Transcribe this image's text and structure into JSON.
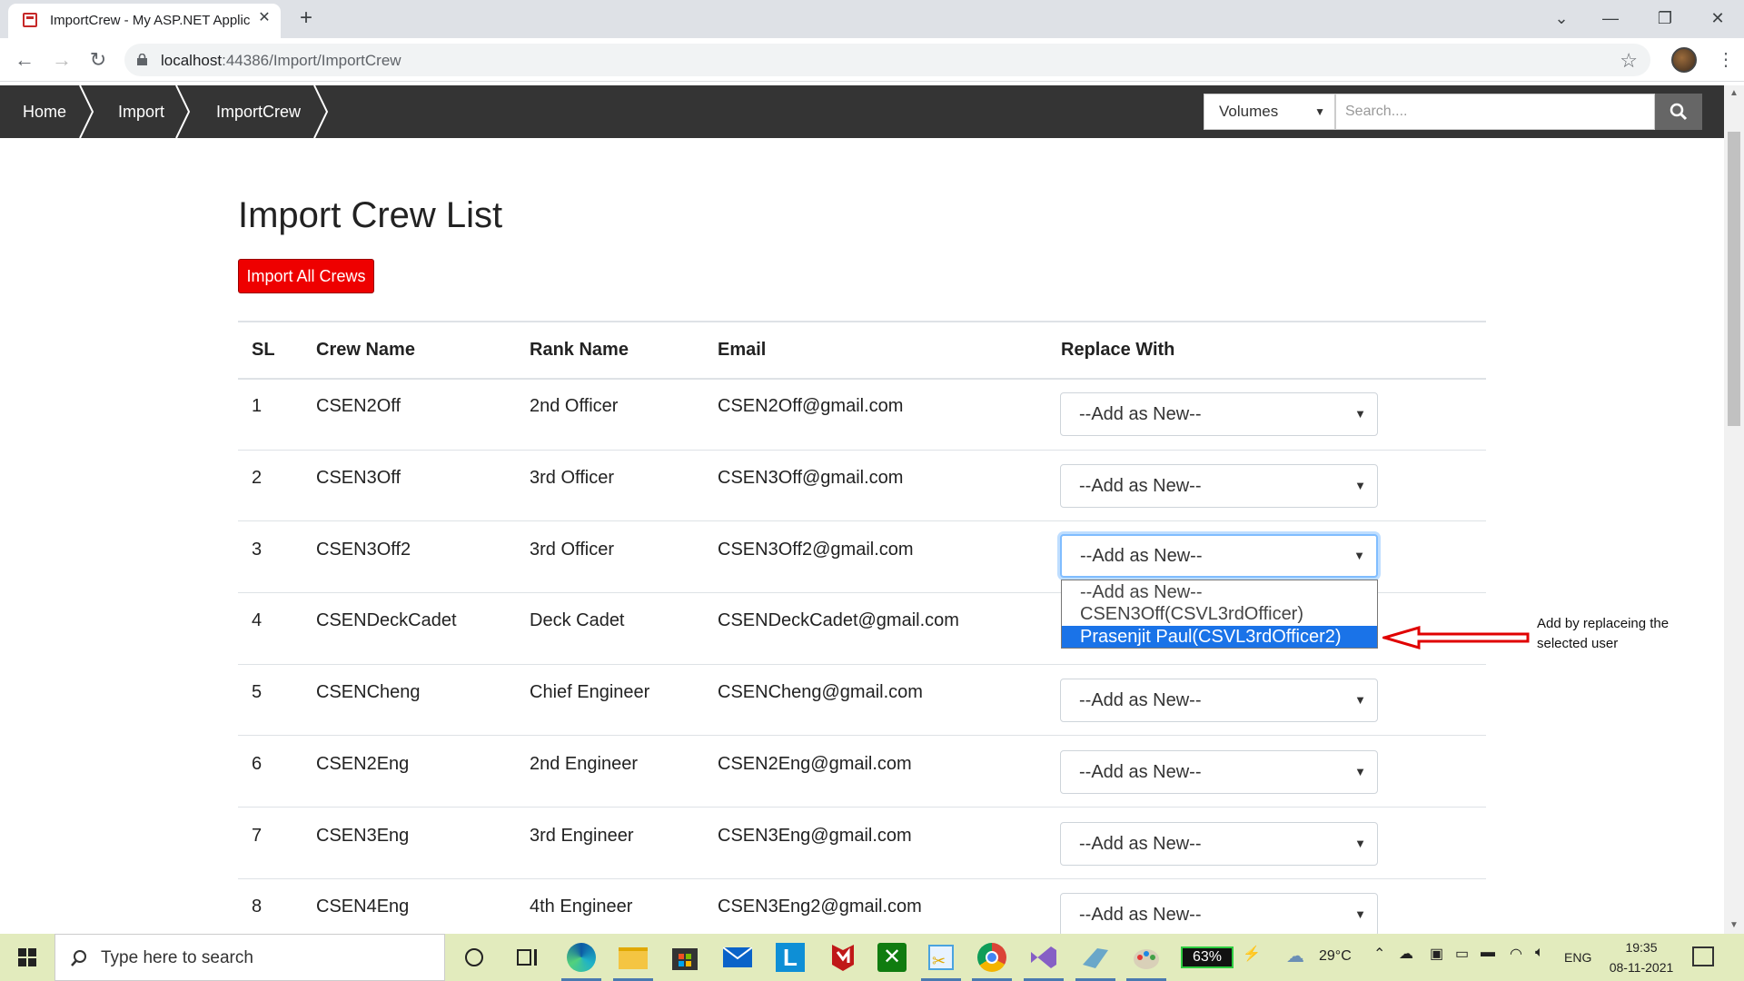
{
  "browser": {
    "tab_title": "ImportCrew - My ASP.NET Applic",
    "url_host": "localhost",
    "url_rest": ":44386/Import/ImportCrew"
  },
  "nav": {
    "breadcrumbs": [
      "Home",
      "Import",
      "ImportCrew"
    ],
    "volumes_label": "Volumes",
    "search_placeholder": "Search...."
  },
  "page": {
    "title": "Import Crew List",
    "import_all_label": "Import All Crews"
  },
  "table": {
    "headers": [
      "SL",
      "Crew Name",
      "Rank Name",
      "Email",
      "Replace With"
    ],
    "rows": [
      {
        "sl": "1",
        "name": "CSEN2Off",
        "rank": "2nd Officer",
        "email": "CSEN2Off@gmail.com",
        "replace": "--Add as New--"
      },
      {
        "sl": "2",
        "name": "CSEN3Off",
        "rank": "3rd Officer",
        "email": "CSEN3Off@gmail.com",
        "replace": "--Add as New--"
      },
      {
        "sl": "3",
        "name": "CSEN3Off2",
        "rank": "3rd Officer",
        "email": "CSEN3Off2@gmail.com",
        "replace": "--Add as New--"
      },
      {
        "sl": "4",
        "name": "CSENDeckCadet",
        "rank": "Deck Cadet",
        "email": "CSENDeckCadet@gmail.com",
        "replace": ""
      },
      {
        "sl": "5",
        "name": "CSENCheng",
        "rank": "Chief Engineer",
        "email": "CSENCheng@gmail.com",
        "replace": "--Add as New--"
      },
      {
        "sl": "6",
        "name": "CSEN2Eng",
        "rank": "2nd Engineer",
        "email": "CSEN2Eng@gmail.com",
        "replace": "--Add as New--"
      },
      {
        "sl": "7",
        "name": "CSEN3Eng",
        "rank": "3rd Engineer",
        "email": "CSEN3Eng@gmail.com",
        "replace": "--Add as New--"
      },
      {
        "sl": "8",
        "name": "CSEN4Eng",
        "rank": "4th Engineer",
        "email": "CSEN3Eng2@gmail.com",
        "replace": "--Add as New--"
      }
    ],
    "dropdown_options": [
      "--Add as New--",
      "CSEN3Off(CSVL3rdOfficer)",
      "Prasenjit Paul(CSVL3rdOfficer2)"
    ]
  },
  "annotation": {
    "text_line1": "Add by replaceing the",
    "text_line2": "selected user",
    "arrow_color": "#e00000"
  },
  "taskbar": {
    "search_text": "Type here to search",
    "battery": "63%",
    "temperature": "29°C",
    "language": "ENG",
    "time": "19:35",
    "date": "08-11-2021"
  }
}
